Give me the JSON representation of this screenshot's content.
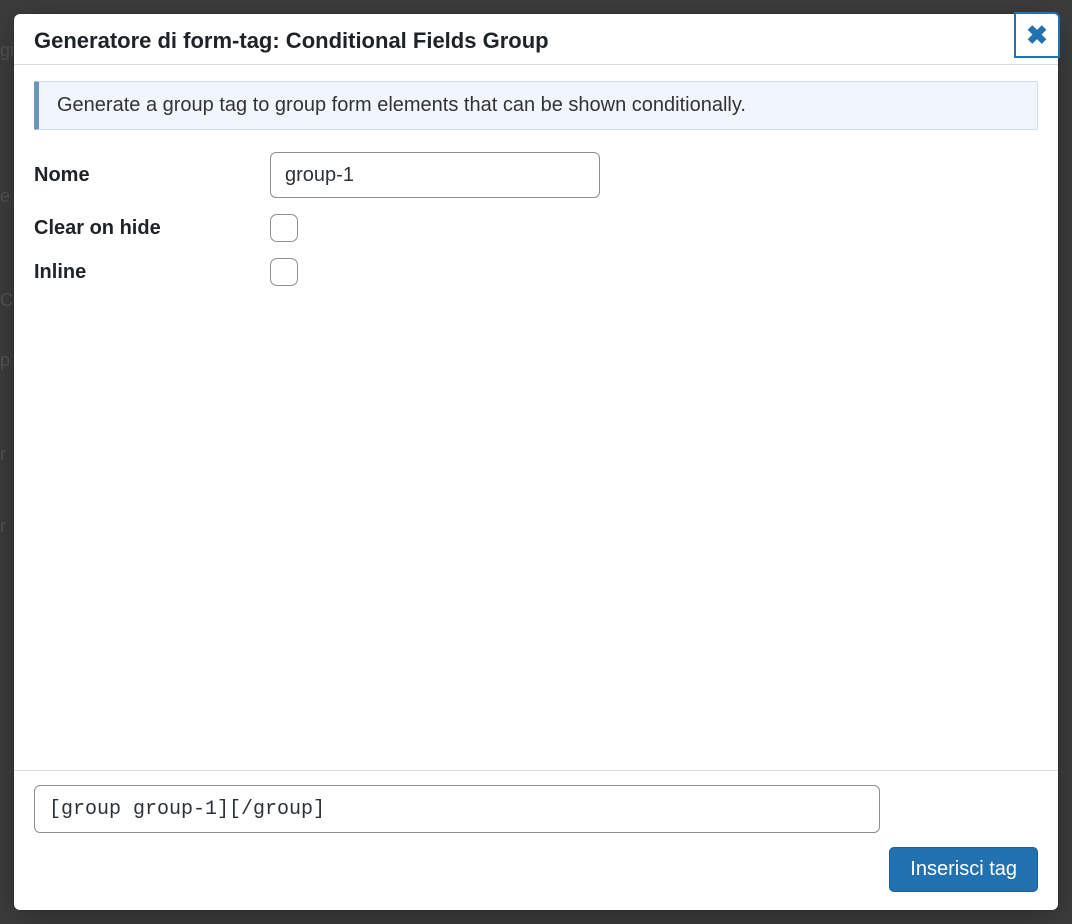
{
  "modal": {
    "title": "Generatore di form-tag: Conditional Fields Group",
    "close_icon": "✖",
    "description": "Generate a group tag to group form elements that can be shown conditionally.",
    "fields": {
      "name_label": "Nome",
      "name_value": "group-1",
      "clear_on_hide_label": "Clear on hide",
      "clear_on_hide_checked": false,
      "inline_label": "Inline",
      "inline_checked": false
    },
    "footer": {
      "generated_tag": "[group group-1][/group]",
      "insert_button_label": "Inserisci tag"
    }
  }
}
